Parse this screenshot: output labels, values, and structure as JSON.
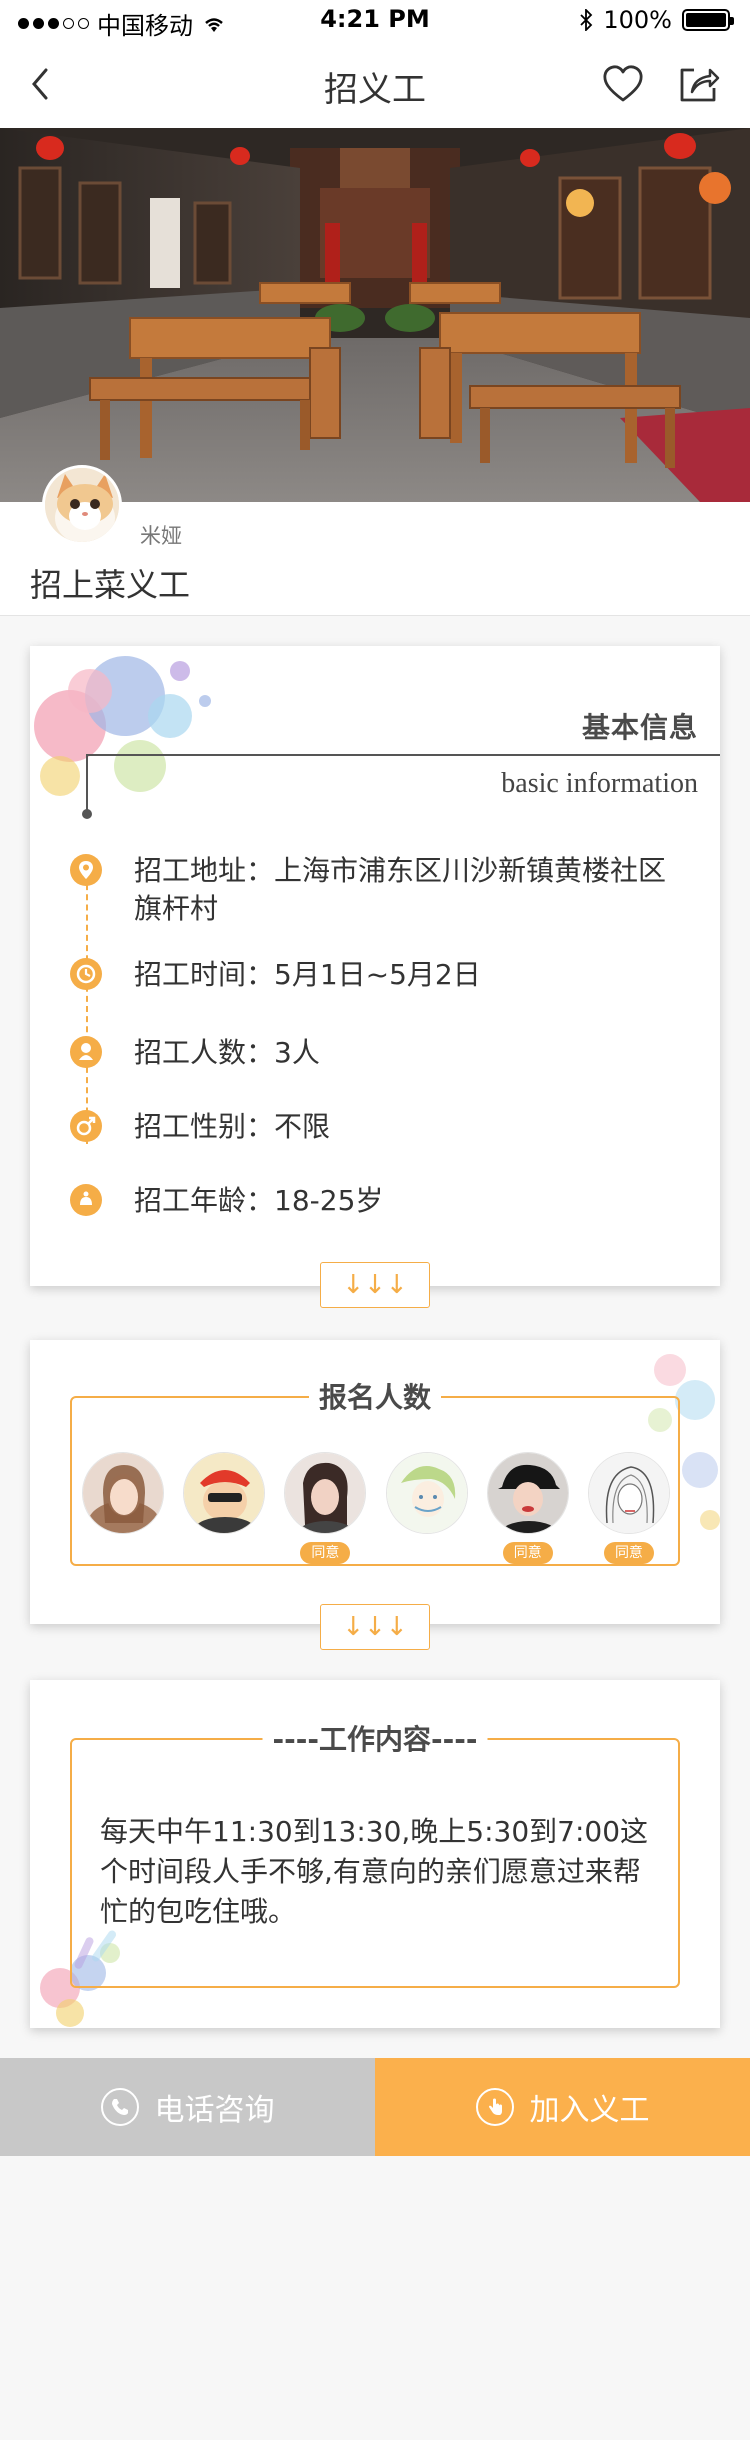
{
  "status_bar": {
    "carrier": "中国移动",
    "time": "4:21 PM",
    "battery": "100%"
  },
  "nav": {
    "title": "招义工",
    "icons": [
      "back-arrow-icon",
      "heart-icon",
      "share-icon"
    ]
  },
  "host": {
    "name": "米娅",
    "event_title": "招上菜义工"
  },
  "basic_info": {
    "title_cn": "基本信息",
    "title_en": "basic information",
    "items": [
      {
        "icon": "location-pin-icon",
        "label": "招工地址：",
        "value": "上海市浦东区川沙新镇黄楼社区旗杆村"
      },
      {
        "icon": "clock-icon",
        "label": "招工时间：",
        "value": "5月1日~5月2日"
      },
      {
        "icon": "person-icon",
        "label": "招工人数：",
        "value": "3人"
      },
      {
        "icon": "gender-icon",
        "label": "招工性别：",
        "value": "不限"
      },
      {
        "icon": "age-icon",
        "label": "招工年龄：",
        "value": "18-25岁"
      }
    ]
  },
  "expand_arrows": "↓↓↓",
  "signups": {
    "title": "报名人数",
    "avatars": [
      {
        "badge": ""
      },
      {
        "badge": ""
      },
      {
        "badge": "同意"
      },
      {
        "badge": ""
      },
      {
        "badge": "同意"
      },
      {
        "badge": "同意"
      }
    ]
  },
  "work": {
    "title": "----工作内容----",
    "content": "每天中午11:30到13:30,晚上5:30到7:00这个时间段人手不够,有意向的亲们愿意过来帮忙的包吃住哦。"
  },
  "bottom": {
    "call_label": "电话咨询",
    "join_label": "加入义工"
  },
  "colors": {
    "accent": "#f5ad47",
    "call_bg": "#c8c8c8",
    "join_bg": "#fbb04c"
  }
}
